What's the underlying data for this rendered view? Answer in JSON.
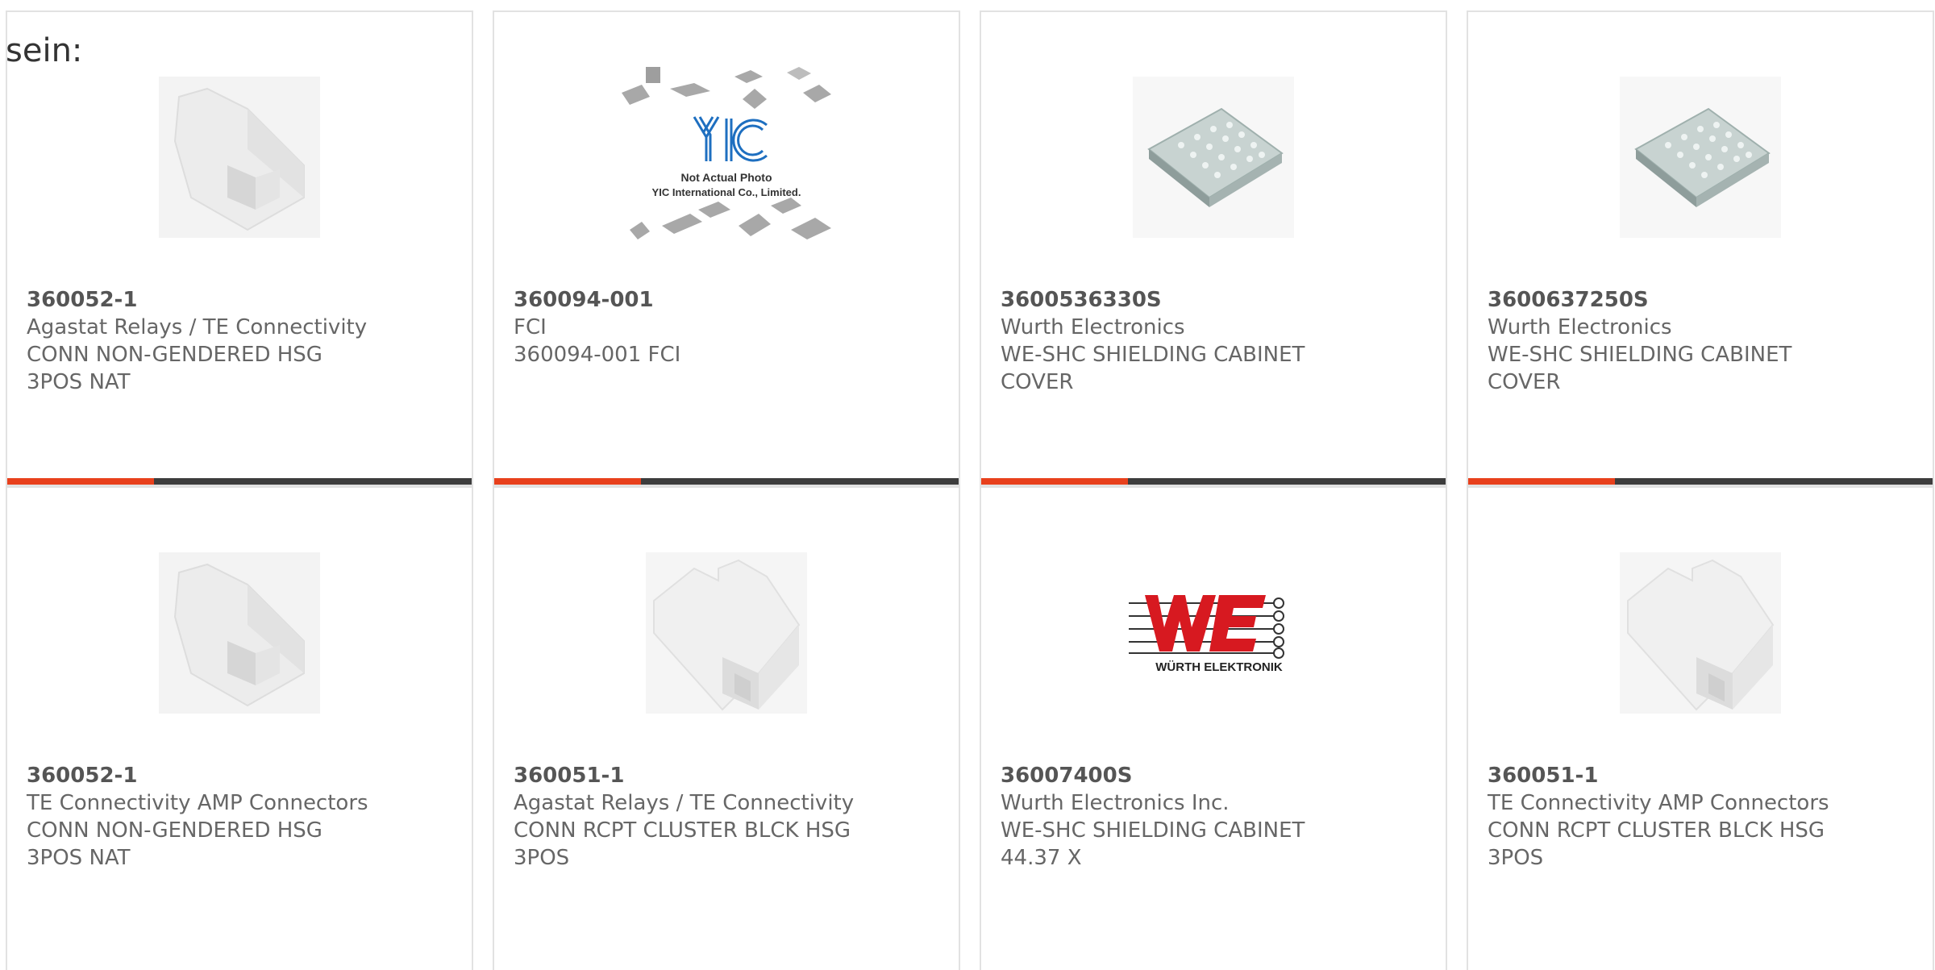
{
  "intro_text": "sein:",
  "colors": {
    "accent": "#e8401c",
    "bar": "#3d3d3d",
    "border": "#e2e2e2",
    "text": "#666666"
  },
  "cards": [
    {
      "part": "360052-1",
      "maker": "Agastat Relays / TE Connectivity",
      "desc1": "CONN NON-GENDERED HSG",
      "desc2": "3POS NAT",
      "image": "housing-pointed"
    },
    {
      "part": "360094-001",
      "maker": "FCI",
      "desc1": "360094-001 FCI",
      "desc2": "",
      "image": "yic-placeholder",
      "image_caption": "Not Actual Photo",
      "image_caption2": "YIC International Co., Limited."
    },
    {
      "part": "3600536330S",
      "maker": "Wurth Electronics",
      "desc1": "WE-SHC SHIELDING CABINET",
      "desc2": "COVER",
      "image": "shield-cover"
    },
    {
      "part": "3600637250S",
      "maker": "Wurth Electronics",
      "desc1": "WE-SHC SHIELDING CABINET",
      "desc2": "COVER",
      "image": "shield-cover"
    },
    {
      "part": "360052-1",
      "maker": "TE Connectivity AMP Connectors",
      "desc1": "CONN NON-GENDERED HSG",
      "desc2": "3POS NAT",
      "image": "housing-pointed"
    },
    {
      "part": "360051-1",
      "maker": "Agastat Relays / TE Connectivity",
      "desc1": "CONN RCPT CLUSTER BLCK HSG",
      "desc2": "3POS",
      "image": "housing-block"
    },
    {
      "part": "36007400S",
      "maker": "Wurth Electronics Inc.",
      "desc1": "WE-SHC SHIELDING CABINET",
      "desc2": "44.37 X",
      "image": "we-logo",
      "logo_text": "WÜRTH ELEKTRONIK"
    },
    {
      "part": "360051-1",
      "maker": "TE Connectivity AMP Connectors",
      "desc1": "CONN RCPT CLUSTER BLCK HSG",
      "desc2": "3POS",
      "image": "housing-block"
    }
  ]
}
